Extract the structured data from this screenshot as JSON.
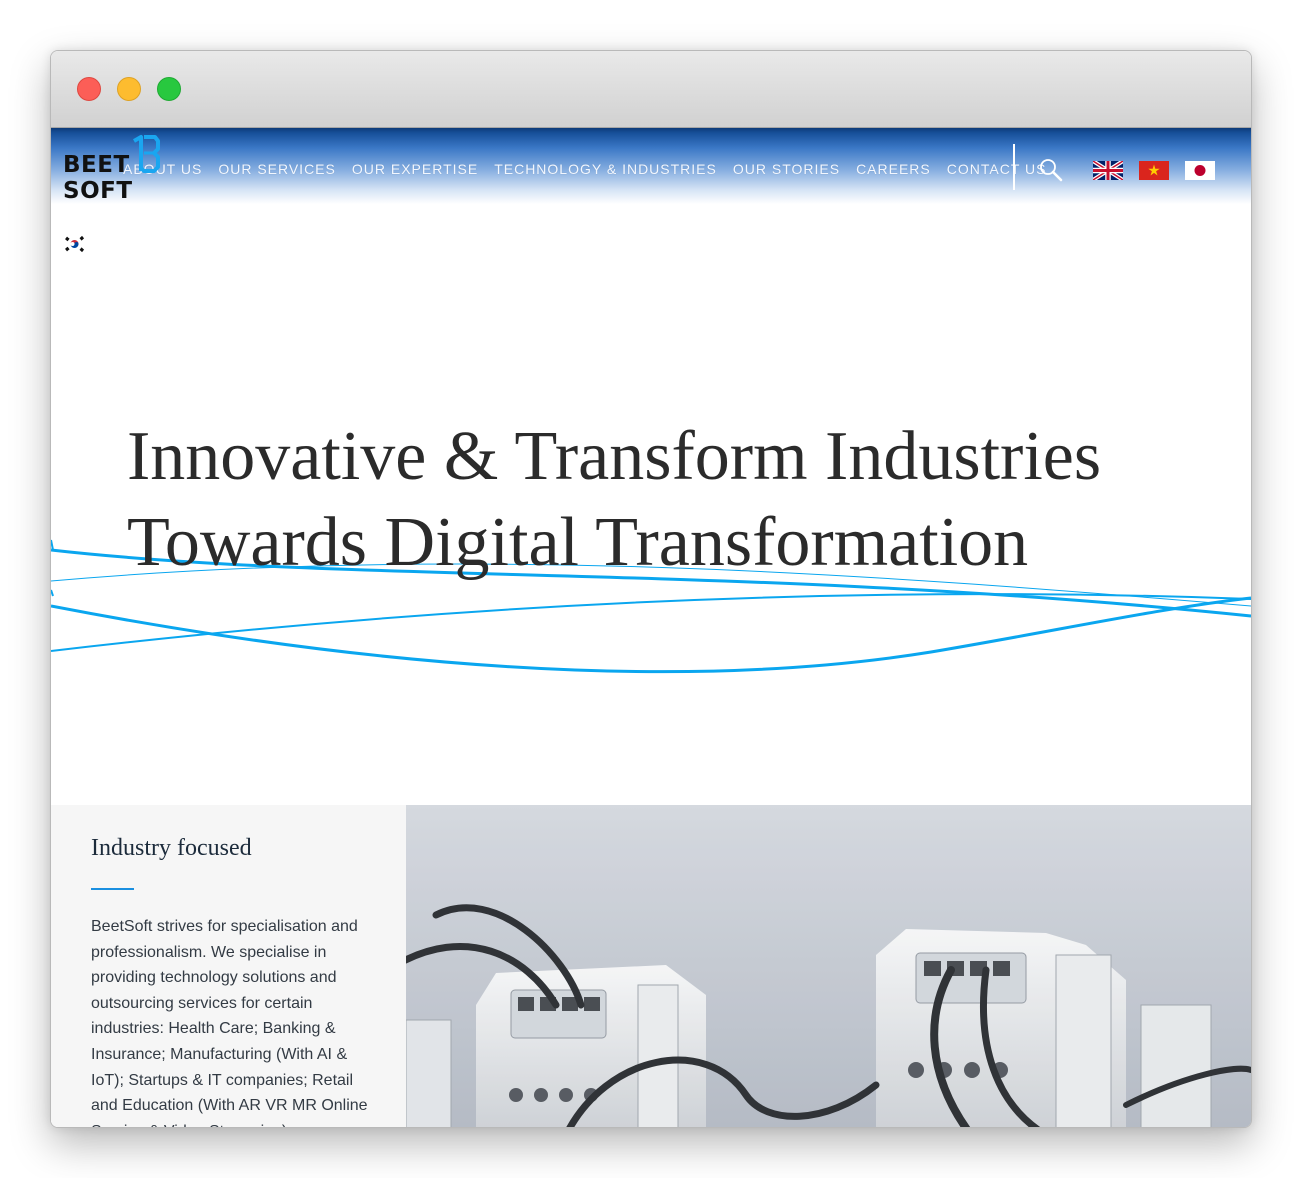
{
  "browser": {
    "controls": [
      "close",
      "minimize",
      "zoom"
    ]
  },
  "header": {
    "logo": {
      "line1": "BEET",
      "line2": "SOFT",
      "mark_color": "#1aa6f0"
    },
    "nav": [
      {
        "label": "ABOUT US"
      },
      {
        "label": "OUR SERVICES"
      },
      {
        "label": "OUR EXPERTISE"
      },
      {
        "label": "TECHNOLOGY & INDUSTRIES"
      },
      {
        "label": "OUR STORIES"
      },
      {
        "label": "CAREERS"
      },
      {
        "label": "CONTACT US"
      }
    ],
    "search_icon": "search-icon",
    "languages": [
      "english-flag",
      "vietnamese-flag",
      "japanese-flag",
      "korean-flag"
    ]
  },
  "hero": {
    "title_line1": "Innovative & Transform Industries",
    "title_line2": "Towards Digital Transformation",
    "wave_color": "#0aa6ef"
  },
  "industry": {
    "title": "Industry focused",
    "text": "BeetSoft strives for specialisation and professionalism. We specialise in providing technology solutions and outsourcing services for certain industries: Health Care; Banking & Insurance; Manufacturing (With AI & IoT); Startups & IT companies; Retail and Education (With AR VR MR Online Service & Video Streaming)",
    "accent": "#1a8fe0"
  }
}
